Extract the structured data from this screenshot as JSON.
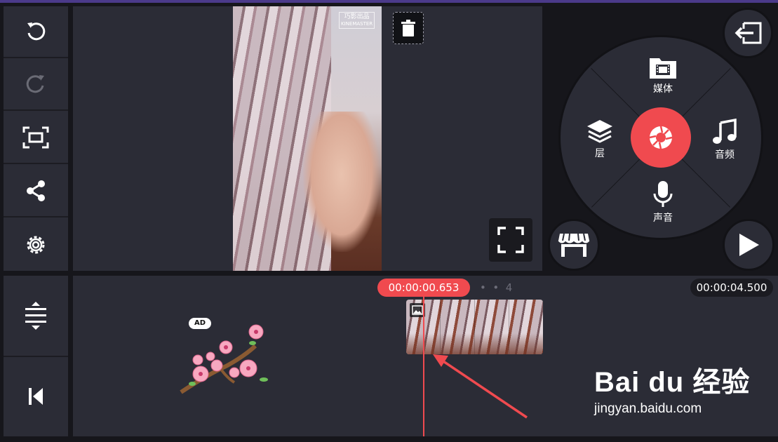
{
  "colors": {
    "accent": "#f04a4f",
    "panel": "#2b2c36",
    "background": "#16161b"
  },
  "sidebar": {
    "items": [
      {
        "icon": "undo-icon"
      },
      {
        "icon": "redo-icon",
        "disabled": true
      },
      {
        "icon": "aspect-ratio-icon"
      },
      {
        "icon": "share-icon"
      },
      {
        "icon": "settings-gear-icon"
      }
    ]
  },
  "preview": {
    "watermark_line1": "巧影出品",
    "watermark_line2": "KINEMASTER"
  },
  "wheel": {
    "media_label": "媒体",
    "layer_label": "层",
    "audio_label": "音频",
    "voice_label": "声音"
  },
  "timeline": {
    "current_time": "00:00:00.653",
    "total_time": "00:00:04.500",
    "page_indicator": "4",
    "ad_badge": "AD"
  },
  "watermark": {
    "brand": "Bai du 经验",
    "url": "jingyan.baidu.com"
  }
}
